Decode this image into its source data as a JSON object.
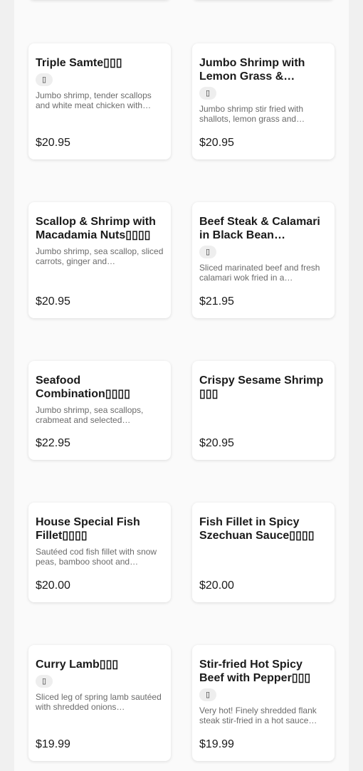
{
  "menu_items": [
    {
      "name": "Triple Samte▯▯▯",
      "badge": "▯",
      "description": "Jumbo shrimp, tender scallops and white meat chicken with…",
      "price": "$20.95"
    },
    {
      "name": "Jumbo Shrimp with Lemon Grass & Peppe…",
      "badge": "▯",
      "description": "Jumbo shrimp stir fried with shallots, lemon grass and…",
      "price": "$20.95"
    },
    {
      "name": "Scallop & Shrimp with Macadamia Nuts▯▯▯▯",
      "badge": "",
      "description": "Jumbo shrimp, sea scallop, sliced carrots, ginger and…",
      "price": "$20.95"
    },
    {
      "name": "Beef Steak & Calamari in Black Bean Sauce▯…",
      "badge": "▯",
      "description": "Sliced marinated beef and fresh calamari wok fried in a…",
      "price": "$21.95"
    },
    {
      "name": "Seafood Combination▯▯▯▯",
      "badge": "",
      "description": "Jumbo shrimp, sea scallops, crabmeat and selected…",
      "price": "$22.95"
    },
    {
      "name": "Crispy Sesame Shrimp ▯▯▯",
      "badge": "",
      "description": "",
      "price": "$20.95"
    },
    {
      "name": "House Special Fish Fillet▯▯▯▯",
      "badge": "",
      "description": "Sautéed cod fish fillet with snow peas, bamboo shoot and…",
      "price": "$20.00"
    },
    {
      "name": "Fish Fillet in Spicy Szechuan Sauce▯▯▯▯",
      "badge": "",
      "description": "",
      "price": "$20.00"
    },
    {
      "name": "Curry Lamb▯▯▯",
      "badge": "▯",
      "description": "Sliced leg of spring lamb sautéed with shredded onions…",
      "price": "$19.99"
    },
    {
      "name": "Stir-fried Hot Spicy Beef with Pepper▯▯▯",
      "badge": "▯",
      "description": "Very hot! Finely shredded flank steak stir-fried in a hot sauce…",
      "price": "$19.99"
    }
  ]
}
